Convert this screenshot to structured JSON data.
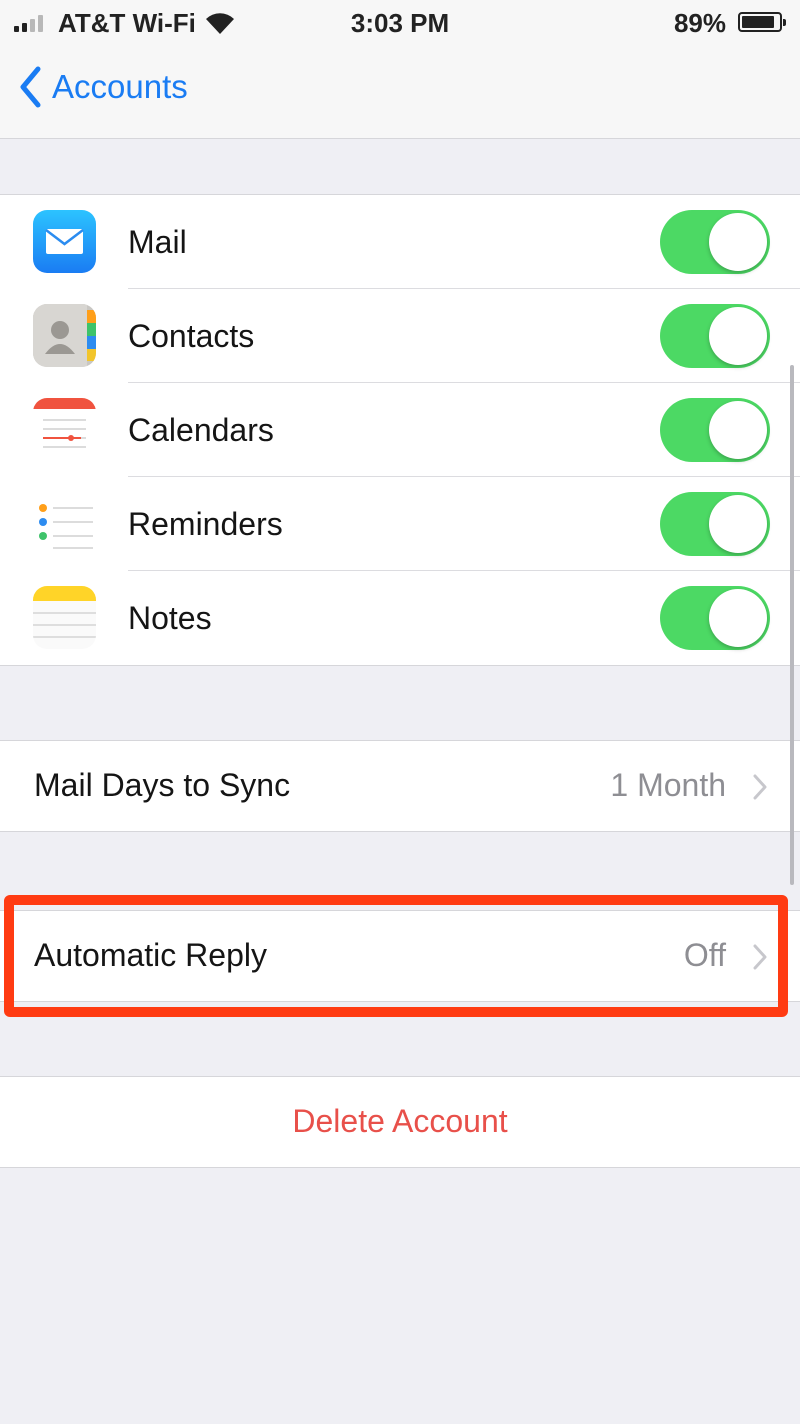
{
  "status_bar": {
    "carrier": "AT&T Wi-Fi",
    "time": "3:03 PM",
    "battery_percent_text": "89%",
    "battery_level": 0.89,
    "signal_icon": "cellular-signal-icon",
    "wifi_icon": "wifi-icon",
    "battery_icon": "battery-icon"
  },
  "nav": {
    "back_label": "Accounts",
    "back_icon": "chevron-left-icon"
  },
  "services": [
    {
      "label": "Mail",
      "icon": "mail-app-icon",
      "enabled": true
    },
    {
      "label": "Contacts",
      "icon": "contacts-app-icon",
      "enabled": true
    },
    {
      "label": "Calendars",
      "icon": "calendar-app-icon",
      "enabled": true
    },
    {
      "label": "Reminders",
      "icon": "reminders-app-icon",
      "enabled": true
    },
    {
      "label": "Notes",
      "icon": "notes-app-icon",
      "enabled": true
    }
  ],
  "sync": {
    "label": "Mail Days to Sync",
    "value": "1 Month"
  },
  "auto_reply": {
    "label": "Automatic Reply",
    "value": "Off"
  },
  "delete": {
    "label": "Delete Account"
  },
  "colors": {
    "accent_blue": "#1a7cf3",
    "toggle_green": "#4cd964",
    "destructive_red": "#e8504a",
    "highlight_red": "#ff3b12",
    "background": "#efeff4"
  }
}
